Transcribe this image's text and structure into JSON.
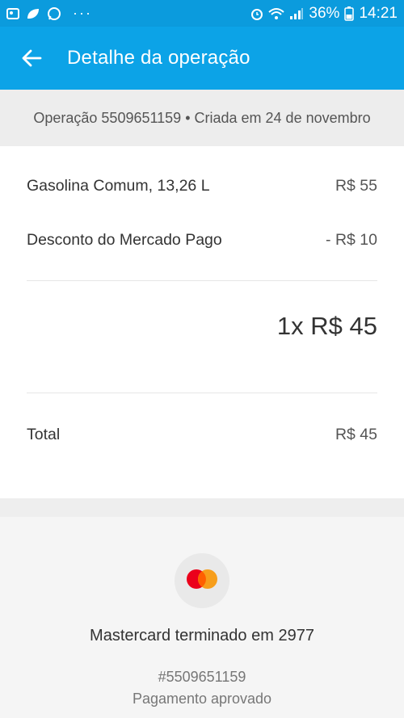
{
  "status_bar": {
    "battery": "36%",
    "time": "14:21",
    "dots": "···",
    "icons": [
      "gallery-icon",
      "leaf-icon",
      "whatsapp-icon",
      "alarm-icon",
      "wifi-icon",
      "signal-icon",
      "battery-icon"
    ]
  },
  "app_bar": {
    "title": "Detalhe da operação",
    "back_icon": "back-arrow-icon"
  },
  "operation": {
    "header": "Operação 5509651159 • Criada em 24 de novembro"
  },
  "items": [
    {
      "label": "Gasolina Comum, 13,26 L",
      "amount": "R$ 55"
    },
    {
      "label": "Desconto do Mercado Pago",
      "amount": "- R$ 10"
    }
  ],
  "installments": "1x R$ 45",
  "total": {
    "label": "Total",
    "amount": "R$ 45"
  },
  "payment": {
    "method": "Mastercard terminado em 2977",
    "id": "#5509651159",
    "status": "Pagamento aprovado",
    "card_icon": "mastercard-icon"
  },
  "colors": {
    "status_bar": "#0b9bdd",
    "app_bar": "#0ca3e7",
    "mastercard_red": "#eb001b",
    "mastercard_orange": "#f79e1b"
  }
}
